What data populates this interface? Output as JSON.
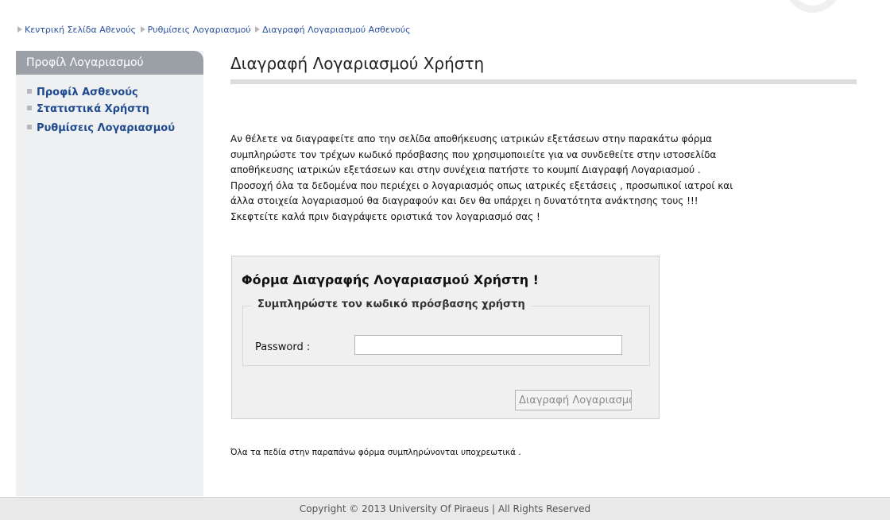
{
  "breadcrumb": {
    "items": [
      "Κεντρική Σελίδα Αθενούς",
      "Ρυθμίσεις Λογαριασμού",
      "Διαγραφή Λογαριασμού Ασθενούς"
    ]
  },
  "sidebar": {
    "header": "Προφίλ Λογαριασμού",
    "items": [
      {
        "label": "Προφίλ Ασθενούς"
      },
      {
        "label": "Στατιστικά Χρήστη"
      },
      {
        "label": "Ρυθμίσεις Λογαριασμού"
      }
    ]
  },
  "main": {
    "title": "Διαγραφή Λογαριασμού Χρήστη",
    "intro_lines": [
      "Αν θέλετε να διαγραφείτε απο την σελίδα αποθήκευσης ιατρικών εξετάσεων στην παρακάτω φόρμα",
      "συμπληρώστε τον τρέχων κωδικό πρόσβασης που χρησιμοποιείτε για να συνδεθείτε στην ιστοσελίδα",
      "αποθήκευσης ιατρικών εξετάσεων και στην συνέχεια πατήστε το κουμπί Διαγραφή Λογαριασμού .",
      "Προσοχή όλα τα δεδομένα που περιέχει ο λογαριασμός οπως ιατρικές εξετάσεις , προσωπικοί ιατροί και",
      "άλλα στοιχεία λογαριασμού θα διαγραφούν και δεν θα υπάρχει η δυνατότητα ανάκτησης τους !!!",
      "Σκεφτείτε καλά πριν διαγράψετε οριστικά τον λογαριασμό σας !"
    ],
    "form": {
      "title": "Φόρμα Διαγραφής Λογαριασμού Χρήστη !",
      "legend": "Συμπληρώστε τον κωδικό πρόσβασης χρήστη",
      "password_label": "Password :",
      "password_value": "",
      "submit_label": "Διαγραφή Λογαριασμού"
    },
    "footnote": "Όλα τα πεδία στην παραπάνω φόρμα συμπληρώνονται υποχρεωτικά ."
  },
  "footer": {
    "copyright": "Copyright © 2013 University Of Piraeus | All Rights Reserved"
  },
  "colors": {
    "link": "#2a4fa0",
    "sidebar_link": "#1f4a8f",
    "sidebar_header_bg": "#9aa0a6",
    "sidebar_bg": "#eef0f2",
    "form_bg": "#f0f0f0",
    "footer_bg": "#e9e9e9"
  },
  "icons": {
    "breadcrumb_separator": "triangle-right-icon",
    "sidebar_bullet": "square-bullet-icon"
  }
}
